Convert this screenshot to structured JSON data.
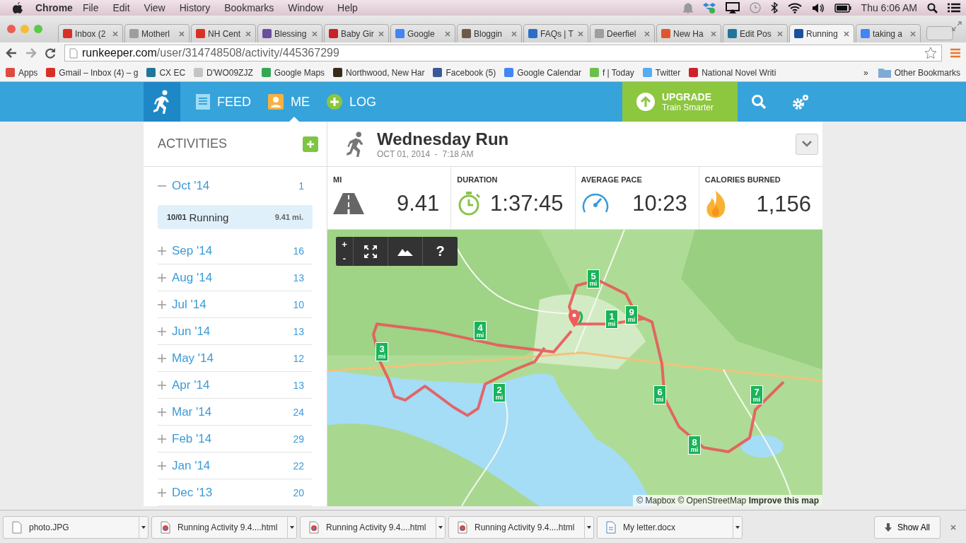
{
  "menu_bar": {
    "app": "Chrome",
    "menus": [
      "File",
      "Edit",
      "View",
      "History",
      "Bookmarks",
      "Window",
      "Help"
    ],
    "clock": "Thu 6:06 AM"
  },
  "tabs": [
    {
      "label": "Inbox (2",
      "selected": false,
      "color": "#d93025"
    },
    {
      "label": "Motherl",
      "selected": false,
      "color": "#9e9e9e"
    },
    {
      "label": "NH Cent",
      "selected": false,
      "color": "#d93025"
    },
    {
      "label": "Blessing",
      "selected": false,
      "color": "#6a4fa0"
    },
    {
      "label": "Baby Gir",
      "selected": false,
      "color": "#cb2027"
    },
    {
      "label": "Google",
      "selected": false,
      "color": "#4285f4"
    },
    {
      "label": "Bloggin",
      "selected": false,
      "color": "#6b5a4a"
    },
    {
      "label": "FAQs | T",
      "selected": false,
      "color": "#2a6fc4"
    },
    {
      "label": "Deerfiel",
      "selected": false,
      "color": "#9e9e9e"
    },
    {
      "label": "New Ha",
      "selected": false,
      "color": "#e0552c"
    },
    {
      "label": "Edit Pos",
      "selected": false,
      "color": "#21759b"
    },
    {
      "label": "Running",
      "selected": true,
      "color": "#1a4fa0"
    },
    {
      "label": "taking a",
      "selected": false,
      "color": "#4285f4"
    }
  ],
  "address_bar": {
    "domain": "runkeeper.com",
    "path": "/user/314748508/activity/445367299"
  },
  "bookmarks": [
    {
      "label": "Apps",
      "color": "#e04a3f"
    },
    {
      "label": "Gmail – Inbox (4) – g",
      "color": "#d93025"
    },
    {
      "label": "CX EC",
      "color": "#21759b"
    },
    {
      "label": "D'WO09ZJZ",
      "color": "#c4c4c4"
    },
    {
      "label": "Google Maps",
      "color": "#34a853"
    },
    {
      "label": "Northwood, New Har",
      "color": "#3a2a1a"
    },
    {
      "label": "Facebook (5)",
      "color": "#3b5998"
    },
    {
      "label": "Google Calendar",
      "color": "#4285f4"
    },
    {
      "label": "f | Today",
      "color": "#6cc04a"
    },
    {
      "label": "Twitter",
      "color": "#55acee"
    },
    {
      "label": "National Novel Writi",
      "color": "#d0202a"
    }
  ],
  "bookmarks_more": "»",
  "other_bookmarks": "Other Bookmarks",
  "nav": {
    "items": [
      {
        "label": "FEED",
        "kind": "feed",
        "selected": false
      },
      {
        "label": "ME",
        "kind": "me",
        "selected": true
      },
      {
        "label": "LOG",
        "kind": "log",
        "selected": false
      }
    ],
    "upgrade": {
      "title": "UPGRADE",
      "subtitle": "Train Smarter"
    }
  },
  "sidebar": {
    "title": "ACTIVITIES",
    "months": [
      {
        "label": "Oct '14",
        "count": "1",
        "expanded": true,
        "activities": [
          {
            "date": "10/01",
            "name": "Running",
            "distance": "9.41 mi.",
            "selected": true
          }
        ]
      },
      {
        "label": "Sep '14",
        "count": "16",
        "expanded": false
      },
      {
        "label": "Aug '14",
        "count": "13",
        "expanded": false
      },
      {
        "label": "Jul '14",
        "count": "10",
        "expanded": false
      },
      {
        "label": "Jun '14",
        "count": "13",
        "expanded": false
      },
      {
        "label": "May '14",
        "count": "12",
        "expanded": false
      },
      {
        "label": "Apr '14",
        "count": "13",
        "expanded": false
      },
      {
        "label": "Mar '14",
        "count": "24",
        "expanded": false
      },
      {
        "label": "Feb '14",
        "count": "29",
        "expanded": false
      },
      {
        "label": "Jan '14",
        "count": "22",
        "expanded": false
      },
      {
        "label": "Dec '13",
        "count": "20",
        "expanded": false
      }
    ]
  },
  "activity": {
    "title": "Wednesday Run",
    "date": "OCT 01, 2014  -  7:18 AM",
    "stats": [
      {
        "kind": "distance",
        "label": "MI",
        "value": "9.41"
      },
      {
        "kind": "duration",
        "label": "DURATION",
        "value": "1:37:45"
      },
      {
        "kind": "pace",
        "label": "AVERAGE PACE",
        "value": "10:23"
      },
      {
        "kind": "calories",
        "label": "CALORIES BURNED",
        "value": "1,156"
      }
    ]
  },
  "map": {
    "kind": "picture",
    "zoom_in": "+",
    "zoom_out": "-",
    "help": "?",
    "mile_markers": [
      {
        "number": "1",
        "unit": "mi"
      },
      {
        "number": "2",
        "unit": "mi"
      },
      {
        "number": "3",
        "unit": "mi"
      },
      {
        "number": "4",
        "unit": "mi"
      },
      {
        "number": "5",
        "unit": "mi"
      },
      {
        "number": "6",
        "unit": "mi"
      },
      {
        "number": "7",
        "unit": "mi"
      },
      {
        "number": "8",
        "unit": "mi"
      },
      {
        "number": "9",
        "unit": "mi"
      }
    ],
    "attribution": "© Mapbox © OpenStreetMap **Improve this map**"
  },
  "downloads": {
    "items": [
      {
        "name": "photo.JPG",
        "kind": "file"
      },
      {
        "name": "Running Activity 9.4....html",
        "kind": "web"
      },
      {
        "name": "Running Activity 9.4....html",
        "kind": "web"
      },
      {
        "name": "Running Activity 9.4....html",
        "kind": "web"
      },
      {
        "name": "My letter.docx",
        "kind": "doc"
      }
    ],
    "show_all": "Show All"
  }
}
